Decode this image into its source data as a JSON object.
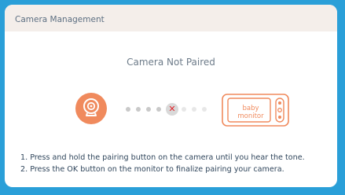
{
  "header": {
    "title": "Camera Management"
  },
  "status": {
    "title": "Camera Not Paired"
  },
  "pairing": {
    "camera_icon": "camera-icon",
    "error_icon": "x-mark",
    "error_glyph": "✕",
    "monitor_label": "baby monitor",
    "accent_color": "#f08a5d",
    "error_color": "#e0262d"
  },
  "instructions": [
    "1. Press and hold the pairing button on the camera until you hear the tone.",
    "2. Press the OK button on the monitor to finalize pairing your camera."
  ]
}
